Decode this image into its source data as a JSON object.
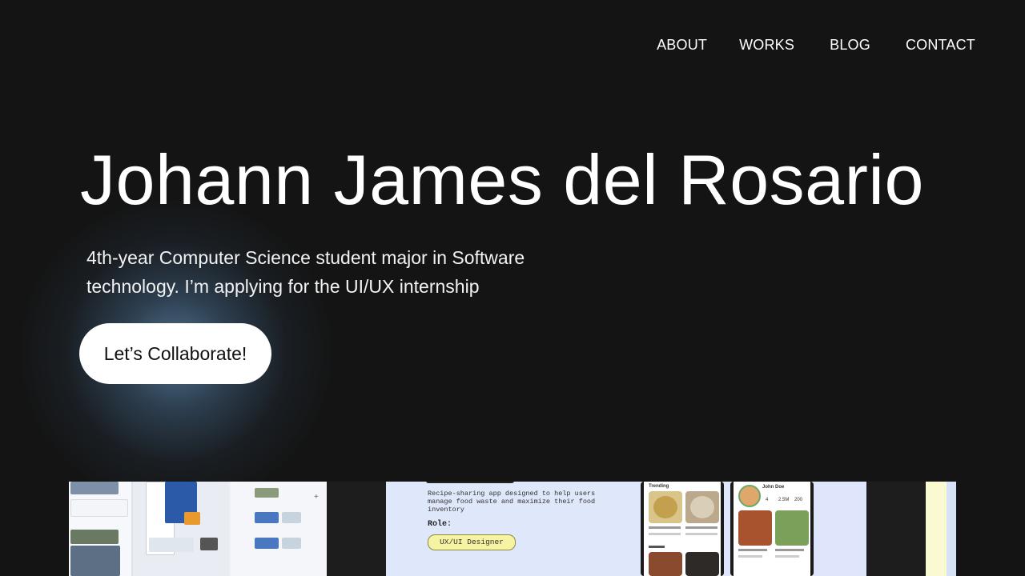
{
  "nav": {
    "about": "ABOUT",
    "works": "WORKS",
    "blog": "BLOG",
    "contact": "CONTACT"
  },
  "hero": {
    "title": "Johann James del Rosario",
    "subtitle_line1": "4th-year Computer Science student major in Software",
    "subtitle_line2": "technology. I’m applying for the UI/UX internship",
    "cta_label": "Let’s Collaborate!"
  },
  "works_preview": {
    "case_description": "Recipe-sharing app designed to help users manage food waste and maximize their food inventory",
    "role_label": "Role:",
    "role_value": "UX/UI Designer",
    "phone1_heading": "Trending",
    "phone2_name": "John Doe",
    "phone2_stats": [
      "4",
      "2.5M",
      "200"
    ]
  },
  "colors": {
    "background": "#141414",
    "text": "#ffffff",
    "cta_bg": "#ffffff",
    "glow": "#4e6f8c"
  }
}
